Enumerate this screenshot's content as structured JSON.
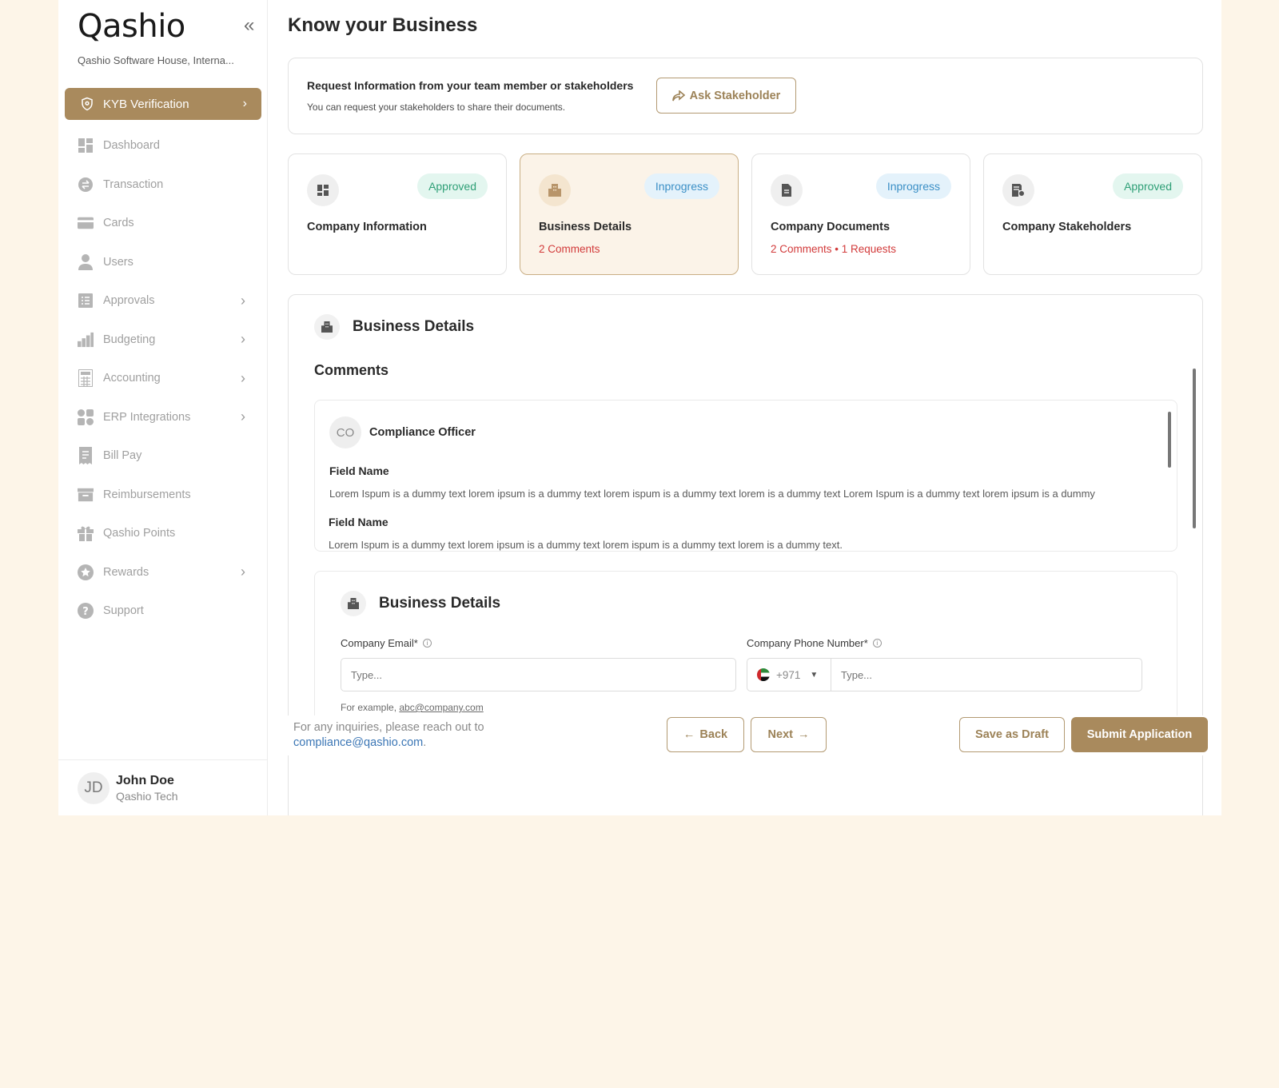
{
  "app": {
    "logo": "Qashio",
    "org_name": "Qashio Software House, Interna...",
    "collapse_icon": "double-chevron-left-icon"
  },
  "sidebar": {
    "active_item": {
      "label": "KYB Verification",
      "icon": "shield-icon"
    },
    "items": [
      {
        "label": "Dashboard",
        "icon": "dashboard-icon",
        "has_submenu": false
      },
      {
        "label": "Transaction",
        "icon": "transaction-icon",
        "has_submenu": false
      },
      {
        "label": "Cards",
        "icon": "card-icon",
        "has_submenu": false
      },
      {
        "label": "Users",
        "icon": "user-icon",
        "has_submenu": false
      },
      {
        "label": "Approvals",
        "icon": "list-icon",
        "has_submenu": true
      },
      {
        "label": "Budgeting",
        "icon": "chart-icon",
        "has_submenu": true
      },
      {
        "label": "Accounting",
        "icon": "calculator-icon",
        "has_submenu": true
      },
      {
        "label": "ERP Integrations",
        "icon": "grid-icon",
        "has_submenu": true
      },
      {
        "label": "Bill Pay",
        "icon": "receipt-icon",
        "has_submenu": false
      },
      {
        "label": "Reimbursements",
        "icon": "archive-icon",
        "has_submenu": false
      },
      {
        "label": "Qashio Points",
        "icon": "gift-icon",
        "has_submenu": false
      },
      {
        "label": "Rewards",
        "icon": "star-icon",
        "has_submenu": true
      },
      {
        "label": "Support",
        "icon": "help-icon",
        "has_submenu": false
      }
    ]
  },
  "user": {
    "initials": "JD",
    "name": "John Doe",
    "org": "Qashio Tech"
  },
  "page": {
    "title": "Know your Business"
  },
  "request": {
    "title": "Request Information from your team member or stakeholders",
    "subtitle": "You can request your stakeholders to share their documents.",
    "button_label": "Ask Stakeholder"
  },
  "steps": [
    {
      "title": "Company Information",
      "status": "Approved",
      "status_kind": "approved",
      "meta": "",
      "icon": "grid-icon",
      "active": false
    },
    {
      "title": "Business Details",
      "status": "Inprogress",
      "status_kind": "progress",
      "meta": "2 Comments",
      "icon": "building-icon",
      "active": true
    },
    {
      "title": "Company Documents",
      "status": "Inprogress",
      "status_kind": "progress",
      "meta": "2 Comments • 1 Requests",
      "icon": "document-icon",
      "active": false
    },
    {
      "title": "Company Stakeholders",
      "status": "Approved",
      "status_kind": "approved",
      "meta": "",
      "icon": "stakeholder-doc-icon",
      "active": false
    }
  ],
  "details": {
    "section_title": "Business Details",
    "comments_title": "Comments",
    "comment": {
      "initials": "CO",
      "author": "Compliance Officer",
      "fields": [
        {
          "name": "Field Name",
          "text": "Lorem Ispum is a dummy text lorem ipsum is a dummy text lorem ispum is a dummy text lorem is a dummy text Lorem Ispum is a dummy text lorem ipsum is a dummy"
        },
        {
          "name": "Field Name",
          "text": "Lorem Ispum is a dummy text lorem ipsum is a dummy text lorem ispum is a dummy text lorem is a dummy text."
        }
      ]
    },
    "form": {
      "title": "Business Details",
      "email_label": "Company Email*",
      "email_placeholder": "Type...",
      "email_hint_prefix": "For example,",
      "email_hint_example": "abc@company.com",
      "phone_label": "Company Phone Number*",
      "phone_code": "+971",
      "phone_placeholder": "Type..."
    }
  },
  "footer": {
    "inquiry_text": "For any inquiries, please reach out to",
    "inquiry_email": "compliance@qashio.com",
    "inquiry_suffix": ".",
    "back_label": "Back",
    "next_label": "Next",
    "draft_label": "Save as Draft",
    "submit_label": "Submit Application"
  },
  "colors": {
    "accent": "#a98a5d",
    "background": "#fdf5e8",
    "approved": "#2e9f76",
    "in_progress": "#3b8fc6",
    "alert": "#d23a3a"
  }
}
